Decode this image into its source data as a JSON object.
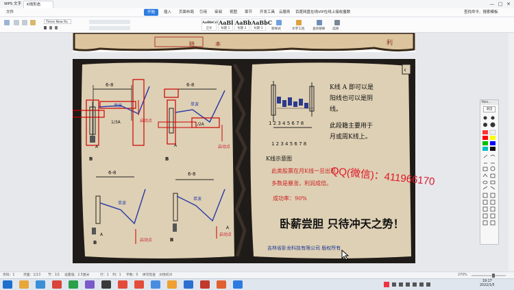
{
  "titlebar": {
    "app_tab": "WPS 文字",
    "doc_tab": "K线形态书.docx",
    "window_controls": [
      "—",
      "□",
      "✕"
    ]
  },
  "menubar": {
    "items": [
      "文件",
      "开始",
      "插入",
      "页面布局",
      "引用",
      "审阅",
      "视图",
      "章节",
      "开发工具",
      "云服务",
      "百度网盘在线VIP在线上接收量数",
      "查找命令、搜索模板"
    ],
    "active_index": 1
  },
  "ribbon": {
    "font_name": "Times New Ro",
    "styles": [
      {
        "sample": "AaBbCcDd",
        "name": "正文"
      },
      {
        "sample": "AaBl",
        "name": "标题 1"
      },
      {
        "sample": "AaBbC",
        "name": "标题 2"
      },
      {
        "sample": "AaBbC",
        "name": "标题 3"
      }
    ],
    "buttons": [
      "新样式",
      "文字工具",
      "查找替换",
      "选择"
    ]
  },
  "figure": {
    "top_label_left": "6-8",
    "top_label_right": "6-8",
    "wave_label_1": "单波",
    "wave_label_2": "单波",
    "ratio_1": "1/3A",
    "ratio_2": "1/2A",
    "start_label": "启动点",
    "axis_a": "A",
    "axis_b": "B",
    "kline_title": "K线示意图",
    "kline_nums": "1 2 3 4 5 6 7 8",
    "text_line1": "K线 A 即可以是",
    "text_line2": "阳线也可以是阴",
    "text_line3": "线。",
    "text_line4": "此段籍主要用于",
    "text_line5": "月或周K线上。",
    "red_text1": "此类股票在月K线一旦出现，",
    "red_text2": "多数是暴涨，利润成倍。",
    "success_rate": "成功率：90%",
    "slogan": "卧薪尝胆 只待冲天之势！",
    "company": "吉林省卧龙科技有限公司  版权所有",
    "bottom_label": "6-8"
  },
  "watermark_text": "QQ(微信)：411966170",
  "ink_toolbar": {
    "title": "Poin...",
    "exit_label": "退出"
  },
  "statusbar": {
    "page": "页码：1",
    "pages": "页面：1/13",
    "section": "节：1/1",
    "setting": "设置值：2.5厘米",
    "row": "行：1",
    "col": "列：1",
    "words": "字数：0",
    "spell": "拼写检查",
    "doc_check": "文档校对",
    "zoom": "270%"
  },
  "taskbar": {
    "time": "19:17",
    "date": "2022/1/5"
  }
}
